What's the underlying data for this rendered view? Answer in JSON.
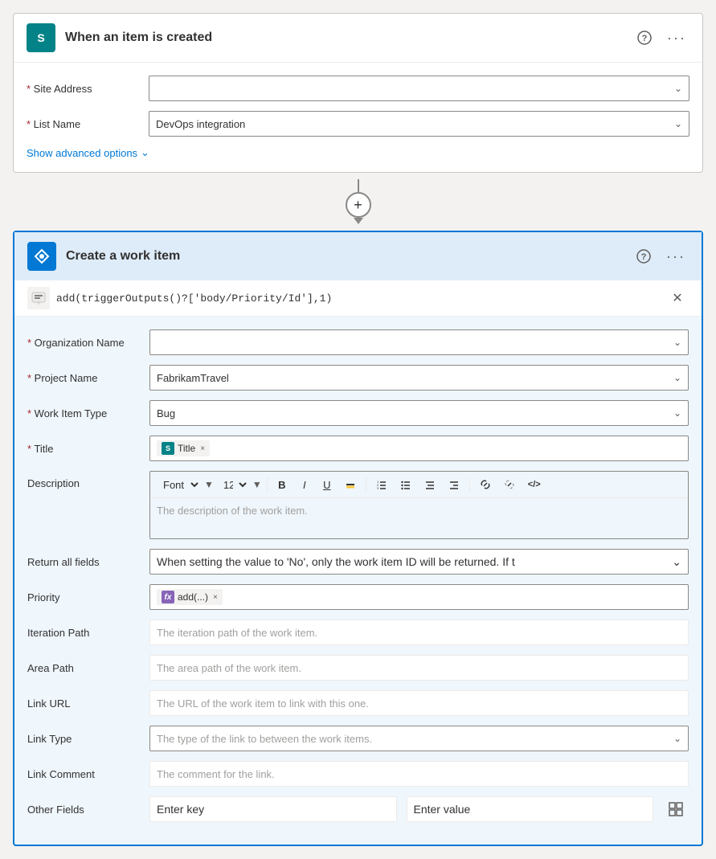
{
  "trigger_card": {
    "title": "When an item is created",
    "help_label": "help",
    "more_label": "more options",
    "site_address_label": "Site Address",
    "site_address_placeholder": "",
    "list_name_label": "List Name",
    "list_name_value": "DevOps integration",
    "show_advanced_label": "Show advanced options"
  },
  "connector": {
    "plus_symbol": "+",
    "arrow_symbol": "▼"
  },
  "action_card": {
    "title": "Create a work item",
    "help_label": "help",
    "more_label": "more options",
    "expression_text": "add(triggerOutputs()?['body/Priority/Id'],1)",
    "expression_icon": "fx",
    "close_label": "close",
    "org_name_label": "Organization Name",
    "org_name_placeholder": "",
    "project_name_label": "Project Name",
    "project_name_value": "FabrikamTravel",
    "work_item_type_label": "Work Item Type",
    "work_item_type_value": "Bug",
    "title_label": "Title",
    "title_chip_label": "Title",
    "title_chip_icon": "S",
    "description_label": "Description",
    "description_font": "Font",
    "description_font_size": "12",
    "description_placeholder": "The description of the work item.",
    "return_all_fields_label": "Return all fields",
    "return_all_fields_placeholder": "When setting the value to 'No', only the work item ID will be returned. If t",
    "priority_label": "Priority",
    "priority_chip_label": "add(...)",
    "priority_chip_icon": "fx",
    "iteration_path_label": "Iteration Path",
    "iteration_path_placeholder": "The iteration path of the work item.",
    "area_path_label": "Area Path",
    "area_path_placeholder": "The area path of the work item.",
    "link_url_label": "Link URL",
    "link_url_placeholder": "The URL of the work item to link with this one.",
    "link_type_label": "Link Type",
    "link_type_placeholder": "The type of the link to between the work items.",
    "link_comment_label": "Link Comment",
    "link_comment_placeholder": "The comment for the link.",
    "other_fields_label": "Other Fields",
    "other_fields_key_placeholder": "Enter key",
    "other_fields_value_placeholder": "Enter value"
  }
}
